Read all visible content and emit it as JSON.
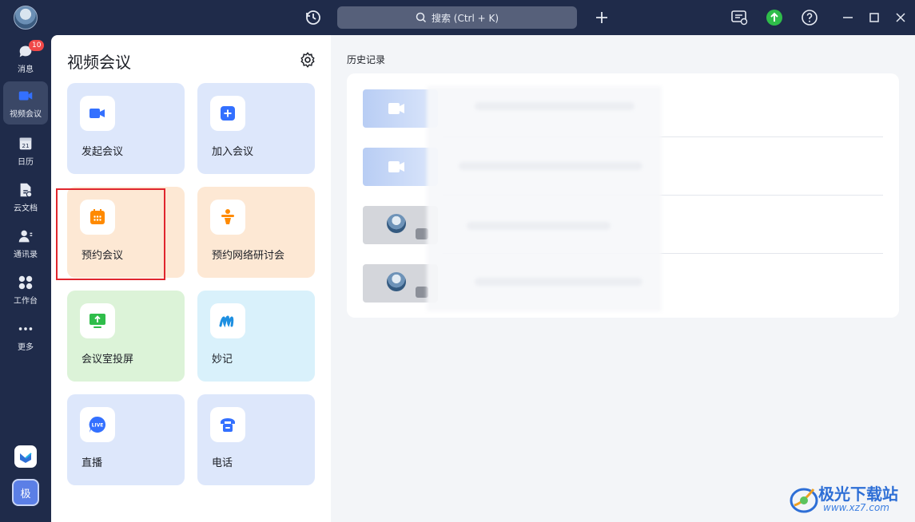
{
  "titlebar": {
    "search_placeholder": "搜索 (Ctrl + K)"
  },
  "nav": {
    "items": [
      {
        "label": "消息",
        "badge": "10",
        "icon": "chat-bubble-icon"
      },
      {
        "label": "视频会议",
        "icon": "video-camera-icon",
        "active": true
      },
      {
        "label": "日历",
        "icon": "calendar-icon",
        "calendar_day": "21"
      },
      {
        "label": "云文档",
        "icon": "cloud-doc-icon"
      },
      {
        "label": "通讯录",
        "icon": "contacts-icon"
      },
      {
        "label": "工作台",
        "icon": "workspace-grid-icon"
      },
      {
        "label": "更多",
        "icon": "more-dots-icon"
      }
    ],
    "user_initial": "极"
  },
  "panel": {
    "title": "视频会议",
    "tiles": [
      {
        "label": "发起会议",
        "icon": "start-meeting-icon",
        "color": "#dde7fb"
      },
      {
        "label": "加入会议",
        "icon": "join-meeting-icon",
        "color": "#dde7fb"
      },
      {
        "label": "预约会议",
        "icon": "schedule-meeting-icon",
        "color": "#fde8d4"
      },
      {
        "label": "预约网络研讨会",
        "icon": "webinar-icon",
        "color": "#fde8d4"
      },
      {
        "label": "会议室投屏",
        "icon": "screen-cast-icon",
        "color": "#dcf3d8"
      },
      {
        "label": "妙记",
        "icon": "minutes-icon",
        "color": "#d9f1fb"
      },
      {
        "label": "直播",
        "icon": "live-icon",
        "color": "#dde7fb"
      },
      {
        "label": "电话",
        "icon": "phone-icon",
        "color": "#dde7fb"
      }
    ]
  },
  "history": {
    "title": "历史记录"
  },
  "watermark": {
    "name": "极光下载站",
    "url": "www.xz7.com"
  },
  "colors": {
    "accent": "#3370ff",
    "highlight_border": "#e0262d",
    "sidebar_bg": "#1f2b4a"
  }
}
